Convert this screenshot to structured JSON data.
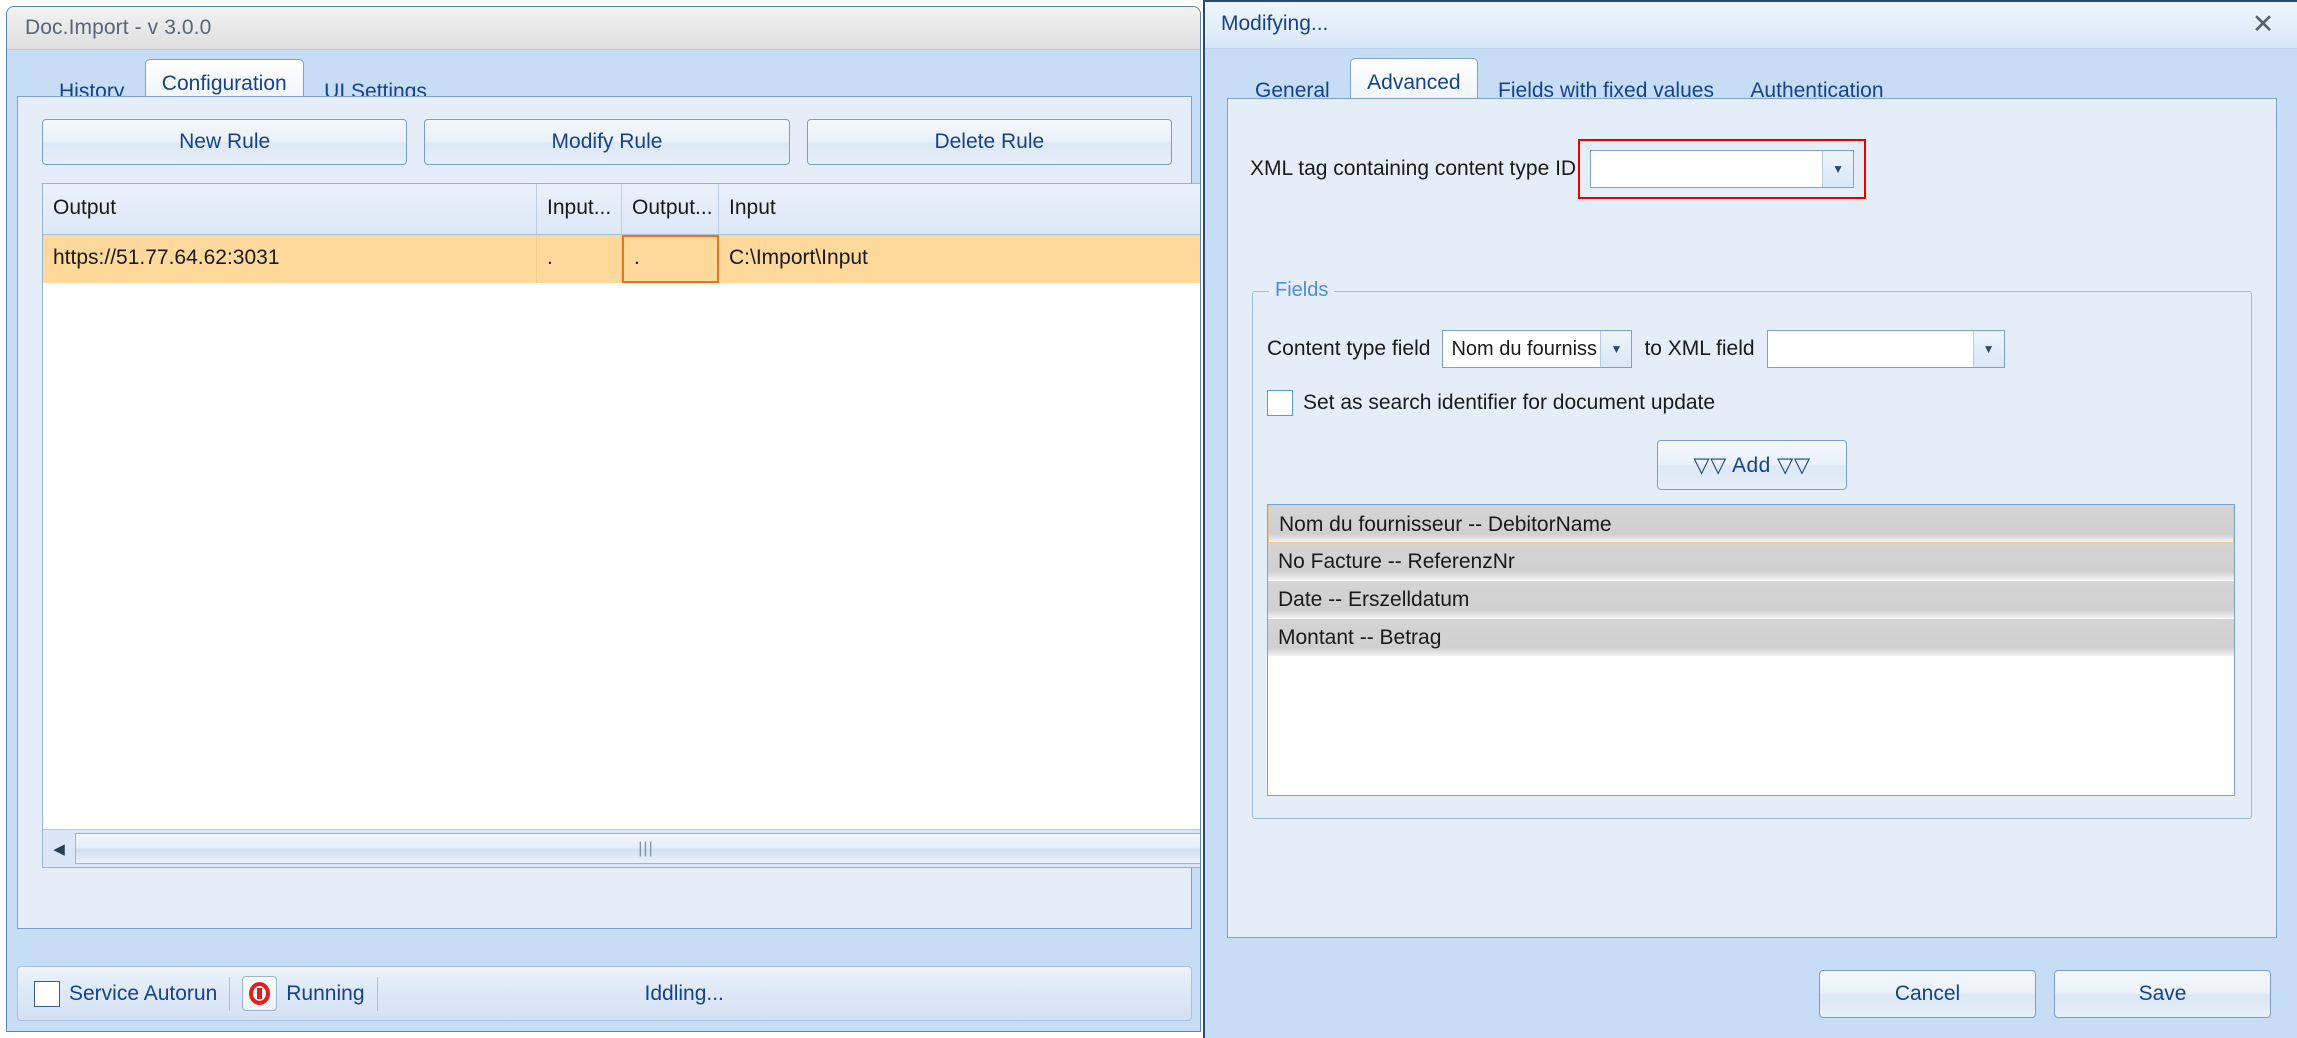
{
  "main_window": {
    "title": "Doc.Import - v 3.0.0",
    "tabs": [
      {
        "label": "History",
        "active": false
      },
      {
        "label": "Configuration",
        "active": true
      },
      {
        "label": "UI Settings",
        "active": false
      }
    ],
    "rule_buttons": [
      {
        "label": "New Rule"
      },
      {
        "label": "Modify Rule"
      },
      {
        "label": "Delete Rule"
      }
    ],
    "grid": {
      "columns": [
        "Output",
        "Input...",
        "Output...",
        "Input"
      ],
      "rows": [
        {
          "output": "https://51.77.64.62:3031",
          "input_short": ".",
          "output_short": ".",
          "input": "C:\\Import\\Input"
        }
      ],
      "selected_row_color": "#fed99b",
      "selected_cell_border_color": "#e8761f",
      "scrollbar_grip": "|||",
      "scroll_left_arrow": "◀"
    },
    "statusbar": {
      "autorun_label": "Service Autorun",
      "autorun_checked": false,
      "service_state": "Running",
      "service_state_icon": "stop-icon",
      "status_message": "Iddling..."
    }
  },
  "dialog": {
    "title": "Modifying...",
    "close_label": "✕",
    "tabs": [
      {
        "label": "General",
        "active": false
      },
      {
        "label": "Advanced",
        "active": true
      },
      {
        "label": "Fields with fixed values",
        "active": false
      },
      {
        "label": "Authentication",
        "active": false
      }
    ],
    "advanced": {
      "xml_tag_label": "XML tag containing content type ID",
      "xml_tag_value": "",
      "xml_tag_highlight_color": "#e60000",
      "fields_group_label": "Fields",
      "content_type_field_label": "Content type field",
      "content_type_field_value": "Nom du fourniss",
      "to_xml_field_label": "to XML field",
      "to_xml_field_value": "",
      "search_identifier_label": "Set as search identifier for document update",
      "search_identifier_checked": false,
      "add_button_label": "▽▽ Add ▽▽",
      "mappings": [
        "Nom du fournisseur -- DebitorName",
        "No Facture -- ReferenzNr",
        "Date -- Erszelldatum",
        "Montant -- Betrag"
      ]
    },
    "buttons": [
      {
        "label": "Cancel"
      },
      {
        "label": "Save"
      }
    ]
  }
}
